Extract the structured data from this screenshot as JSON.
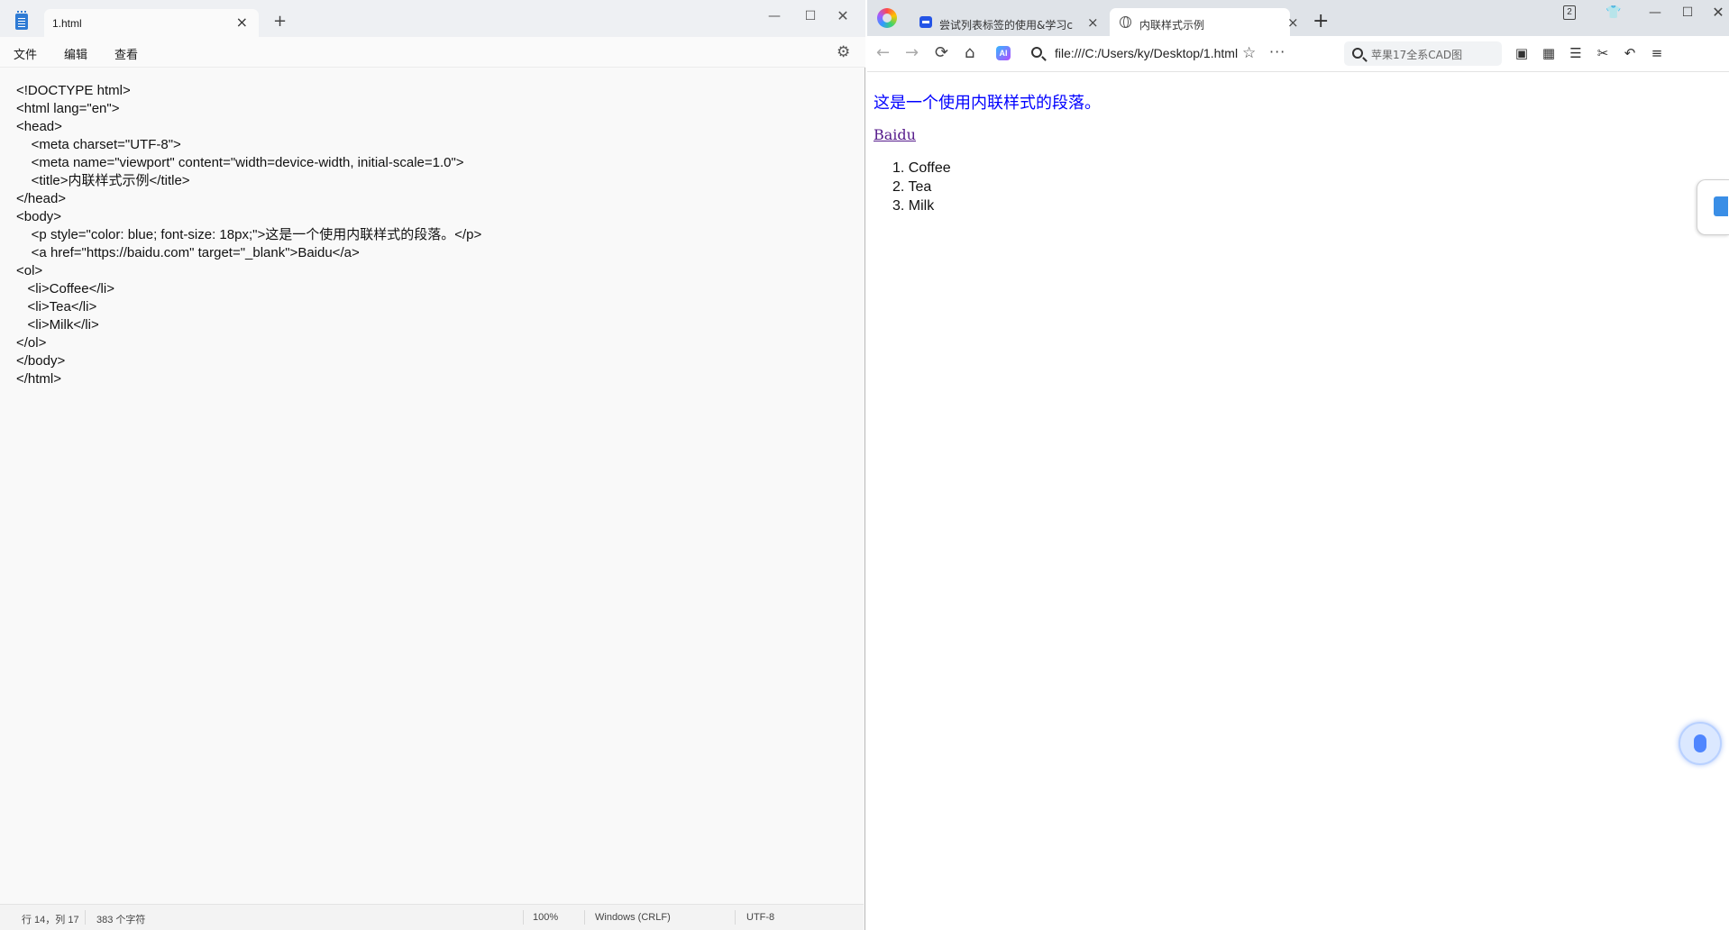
{
  "notepad": {
    "tab_title": "1.html",
    "menu": [
      "文件",
      "编辑",
      "查看"
    ],
    "code_lines": [
      "<!DOCTYPE html>",
      "<html lang=\"en\">",
      "<head>",
      "    <meta charset=\"UTF-8\">",
      "    <meta name=\"viewport\" content=\"width=device-width, initial-scale=1.0\">",
      "    <title>内联样式示例</title>",
      "</head>",
      "<body>",
      "    <p style=\"color: blue; font-size: 18px;\">这是一个使用内联样式的段落。</p>",
      "    <a href=\"https://baidu.com\" target=\"_blank\">Baidu</a>",
      "<ol>",
      "   <li>Coffee</li>",
      "   <li>Tea</li>",
      "   <li>Milk</li>",
      "</ol>",
      "</body>",
      "</html>"
    ],
    "status": {
      "position": "行 14，列 17",
      "chars": "383 个字符",
      "zoom": "100%",
      "line_ending": "Windows (CRLF)",
      "encoding": "UTF-8"
    }
  },
  "browser": {
    "tabs": [
      {
        "title": "尝试列表标签的使用&学习c",
        "active": false
      },
      {
        "title": "内联样式示例",
        "active": true
      }
    ],
    "tab_count_badge": "2",
    "address": "file:///C:/Users/ky/Desktop/1.html",
    "search_placeholder": "苹果17全系CAD图",
    "ai_badge": "AI",
    "page": {
      "paragraph": "这是一个使用内联样式的段落。",
      "paragraph_color": "#0000ff",
      "link_text": "Baidu",
      "list_items": [
        "1. Coffee",
        "2. Tea",
        "3. Milk"
      ]
    }
  }
}
